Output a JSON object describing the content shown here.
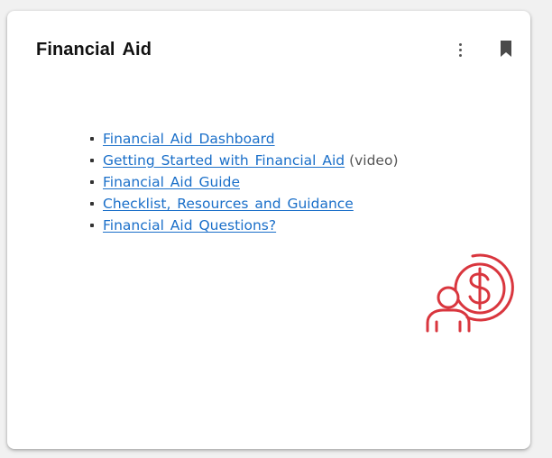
{
  "card": {
    "title": "Financial Aid",
    "menu_icon": "kebab-vertical-icon",
    "bookmark_icon": "bookmark-icon",
    "links": [
      {
        "label": "Financial Aid Dashboard",
        "suffix": ""
      },
      {
        "label": "Getting Started with Financial Aid",
        "suffix": "(video)"
      },
      {
        "label": "Financial Aid Guide",
        "suffix": ""
      },
      {
        "label": "Checklist, Resources and Guidance",
        "suffix": ""
      },
      {
        "label": "Financial Aid Questions?",
        "suffix": ""
      }
    ],
    "illustration_icon": "person-with-dollar-coin-icon"
  },
  "colors": {
    "link": "#1a6fc9",
    "icon_accent": "#d9363e",
    "title": "#111111"
  }
}
